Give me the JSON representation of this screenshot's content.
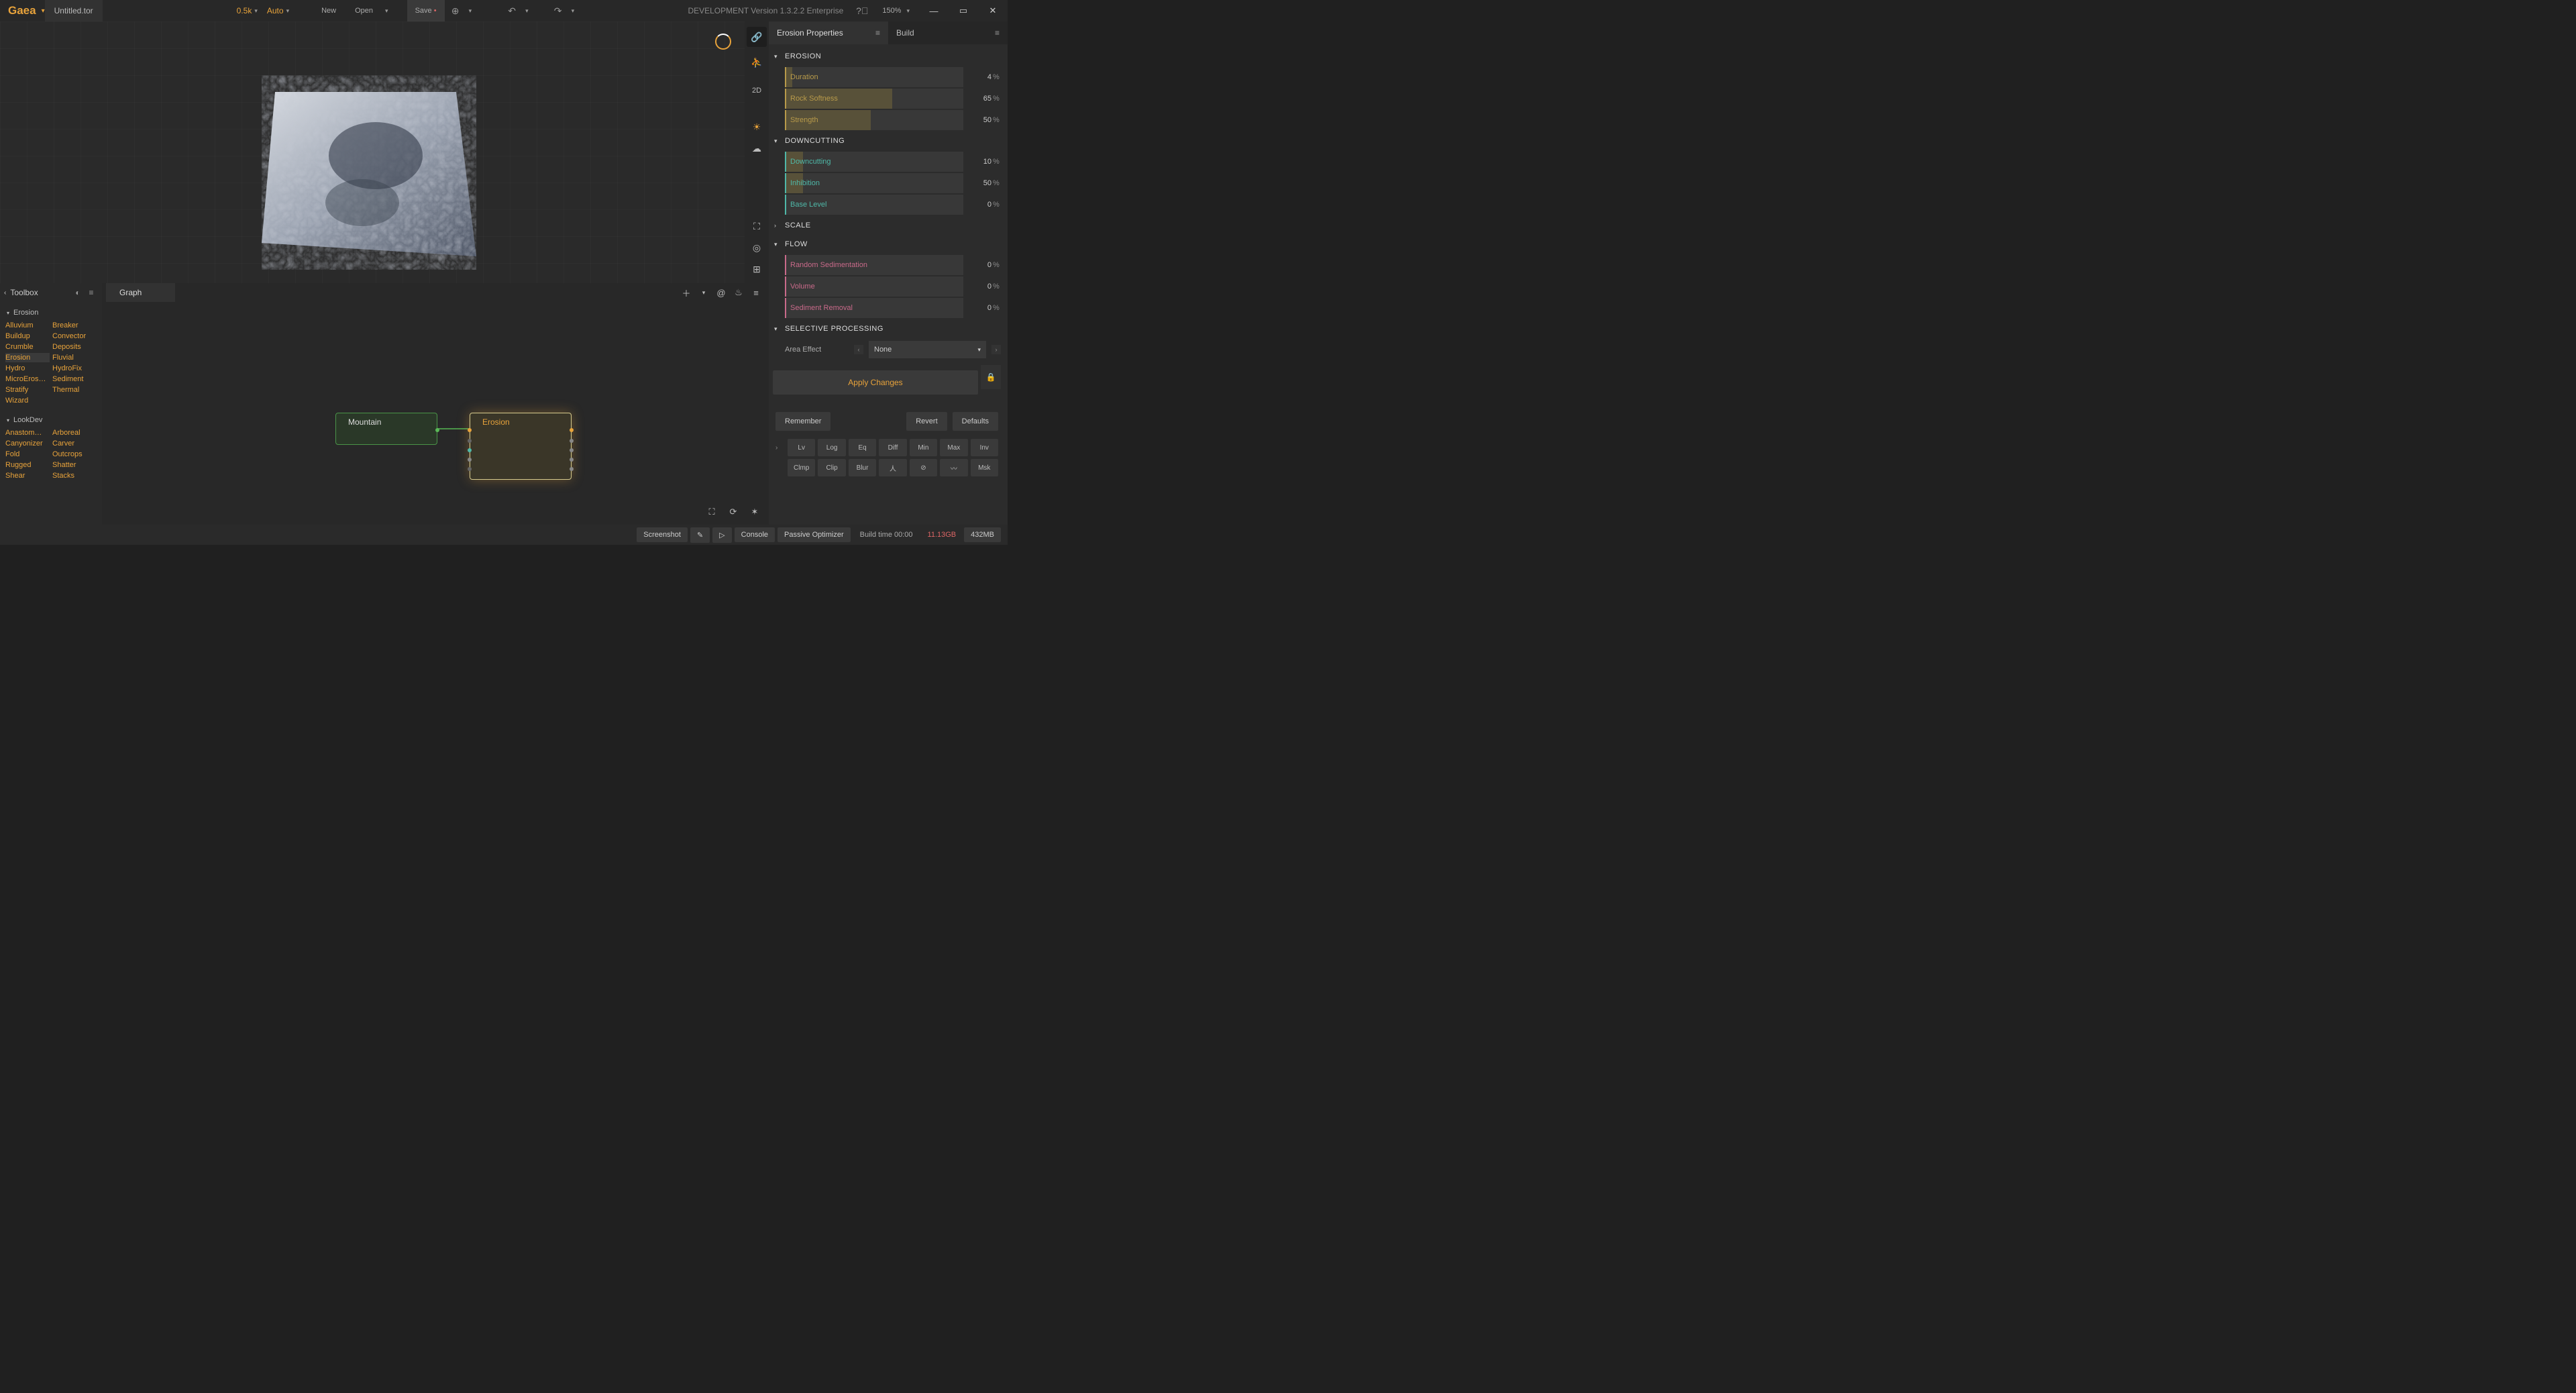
{
  "titlebar": {
    "logo": "Gaea",
    "filename": "Untitled.tor",
    "resolution": "0.5k",
    "auto": "Auto",
    "new": "New",
    "open": "Open",
    "save": "Save",
    "dev_text": "DEVELOPMENT Version 1.3.2.2 Enterprise",
    "zoom": "150%"
  },
  "viewport": {
    "mode_2d": "2D"
  },
  "toolbox": {
    "title": "Toolbox",
    "sections": [
      {
        "name": "Erosion",
        "items": [
          "Alluvium",
          "Breaker",
          "Buildup",
          "Convector",
          "Crumble",
          "Deposits",
          "Erosion",
          "Fluvial",
          "Hydro",
          "HydroFix",
          "MicroEros…",
          "Sediment",
          "Stratify",
          "Thermal",
          "Wizard",
          ""
        ]
      },
      {
        "name": "LookDev",
        "items": [
          "Anastom…",
          "Arboreal",
          "Canyonizer",
          "Carver",
          "Fold",
          "Outcrops",
          "Rugged",
          "Shatter",
          "Shear",
          "Stacks"
        ]
      }
    ]
  },
  "graph": {
    "tab": "Graph",
    "nodes": {
      "mountain": "Mountain",
      "erosion": "Erosion"
    }
  },
  "properties": {
    "tab1": "Erosion Properties",
    "tab2": "Build",
    "sections": {
      "erosion": {
        "title": "EROSION",
        "params": [
          {
            "label": "Duration",
            "value": "4",
            "fill": 4,
            "accent": "#b89a4a"
          },
          {
            "label": "Rock Softness",
            "value": "65",
            "fill": 60,
            "accent": "#b89a4a"
          },
          {
            "label": "Strength",
            "value": "50",
            "fill": 48,
            "accent": "#b89a4a"
          }
        ]
      },
      "downcutting": {
        "title": "DOWNCUTTING",
        "params": [
          {
            "label": "Downcutting",
            "value": "10",
            "fill": 10,
            "accent": "#4fb8a8"
          },
          {
            "label": "Inhibition",
            "value": "50",
            "fill": 10,
            "accent": "#4fb8a8"
          },
          {
            "label": "Base Level",
            "value": "0",
            "fill": 0,
            "accent": "#4fb8a8"
          }
        ]
      },
      "scale": {
        "title": "SCALE"
      },
      "flow": {
        "title": "FLOW",
        "params": [
          {
            "label": "Random Sedimentation",
            "value": "0",
            "fill": 0,
            "accent": "#c96a8a"
          },
          {
            "label": "Volume",
            "value": "0",
            "fill": 0,
            "accent": "#c96a8a"
          },
          {
            "label": "Sediment Removal",
            "value": "0",
            "fill": 0,
            "accent": "#c96a8a"
          }
        ]
      },
      "selective": {
        "title": "SELECTIVE PROCESSING",
        "area_label": "Area Effect",
        "area_value": "None"
      }
    },
    "apply": "Apply Changes",
    "remember": "Remember",
    "revert": "Revert",
    "defaults": "Defaults",
    "small": [
      "Lv",
      "Log",
      "Eq",
      "Diff",
      "Min",
      "Max",
      "Inv",
      "Clmp",
      "Clip",
      "Blur",
      "人",
      "⊘",
      "〰",
      "Msk"
    ]
  },
  "statusbar": {
    "screenshot": "Screenshot",
    "console": "Console",
    "passive": "Passive Optimizer",
    "build_time": "Build time 00:00",
    "mem1": "11.13GB",
    "mem2": "432MB"
  }
}
